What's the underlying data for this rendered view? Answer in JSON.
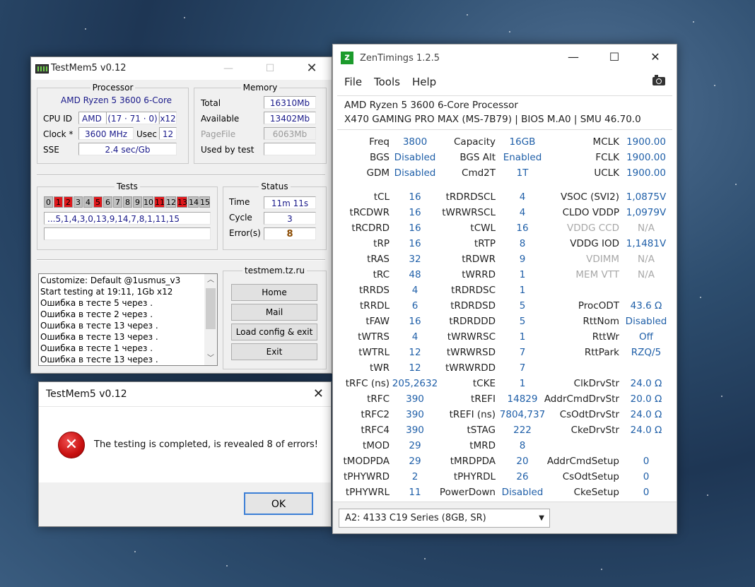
{
  "testmem": {
    "title": "TestMem5 v0.12",
    "processor": {
      "group": "Processor",
      "name": "AMD Ryzen 5 3600 6-Core",
      "cpuid_label": "CPU ID",
      "cpuid_vendor": "AMD",
      "cpuid_value": "(17 · 71 · 0)",
      "cpuid_mult": "x12",
      "clock_label": "Clock *",
      "clock_value": "3600 MHz",
      "usec_label": "Usec",
      "usec_value": "12",
      "sse_label": "SSE",
      "sse_value": "2.4 sec/Gb"
    },
    "memory": {
      "group": "Memory",
      "total_label": "Total",
      "total_value": "16310Mb",
      "available_label": "Available",
      "available_value": "13402Mb",
      "pagefile_label": "PageFile",
      "pagefile_value": "6063Mb",
      "used_label": "Used by test",
      "used_value": ""
    },
    "tests": {
      "group": "Tests",
      "cells": [
        {
          "n": "0",
          "s": "ok"
        },
        {
          "n": "1",
          "s": "err"
        },
        {
          "n": "2",
          "s": "err"
        },
        {
          "n": "3",
          "s": "ok"
        },
        {
          "n": "4",
          "s": "ok"
        },
        {
          "n": "5",
          "s": "err"
        },
        {
          "n": "6",
          "s": "ok"
        },
        {
          "n": "7",
          "s": "ok"
        },
        {
          "n": "8",
          "s": "ok"
        },
        {
          "n": "9",
          "s": "ok"
        },
        {
          "n": "10",
          "s": "ok"
        },
        {
          "n": "11",
          "s": "err"
        },
        {
          "n": "12",
          "s": "ok"
        },
        {
          "n": "13",
          "s": "err"
        },
        {
          "n": "14",
          "s": "ok"
        },
        {
          "n": "15",
          "s": "ok"
        }
      ],
      "sequence": "...5,1,4,3,0,13,9,14,7,8,1,11,15",
      "progress": ""
    },
    "status": {
      "group": "Status",
      "time_label": "Time",
      "time_value": "11m 11s",
      "cycle_label": "Cycle",
      "cycle_value": "3",
      "errors_label": "Error(s)",
      "errors_value": "8"
    },
    "log": [
      "Customize: Default @1usmus_v3",
      "Start testing at 19:11, 1Gb x12",
      "Ошибка в тесте 5 через .",
      "Ошибка в тесте 2 через .",
      "Ошибка в тесте 13 через .",
      "Ошибка в тесте 13 через .",
      "Ошибка в тесте 1 через .",
      "Ошибка в тесте 13 через ."
    ],
    "links": {
      "group": "testmem.tz.ru",
      "home": "Home",
      "mail": "Mail",
      "load": "Load config & exit",
      "exit": "Exit"
    }
  },
  "dialog": {
    "title": "TestMem5 v0.12",
    "message": "The testing is completed, is revealed 8 of errors!",
    "ok": "OK",
    "icon": "error-icon"
  },
  "zentimings": {
    "title": "ZenTimings 1.2.5",
    "menu": [
      "File",
      "Tools",
      "Help"
    ],
    "cpu": "AMD Ryzen 5 3600 6-Core Processor",
    "board": "X470 GAMING PRO MAX (MS-7B79) | BIOS M.A0 | SMU 46.70.0",
    "top": [
      [
        "Freq",
        "3800",
        "Capacity",
        "16GB",
        "MCLK",
        "1900.00"
      ],
      [
        "BGS",
        "Disabled",
        "BGS Alt",
        "Enabled",
        "FCLK",
        "1900.00"
      ],
      [
        "GDM",
        "Disabled",
        "Cmd2T",
        "1T",
        "UCLK",
        "1900.00"
      ]
    ],
    "rows": [
      [
        "tCL",
        "16",
        "tRDRDSCL",
        "4",
        "VSOC (SVI2)",
        "1,0875V"
      ],
      [
        "tRCDWR",
        "16",
        "tWRWRSCL",
        "4",
        "CLDO VDDP",
        "1,0979V"
      ],
      [
        "tRCDRD",
        "16",
        "tCWL",
        "16",
        "VDDG CCD",
        "N/A"
      ],
      [
        "tRP",
        "16",
        "tRTP",
        "8",
        "VDDG IOD",
        "1,1481V"
      ],
      [
        "tRAS",
        "32",
        "tRDWR",
        "9",
        "VDIMM",
        "N/A"
      ],
      [
        "tRC",
        "48",
        "tWRRD",
        "1",
        "MEM VTT",
        "N/A"
      ],
      [
        "tRRDS",
        "4",
        "tRDRDSC",
        "1",
        "",
        ""
      ],
      [
        "tRRDL",
        "6",
        "tRDRDSD",
        "5",
        "ProcODT",
        "43.6 Ω"
      ],
      [
        "tFAW",
        "16",
        "tRDRDDD",
        "5",
        "RttNom",
        "Disabled"
      ],
      [
        "tWTRS",
        "4",
        "tWRWRSC",
        "1",
        "RttWr",
        "Off"
      ],
      [
        "tWTRL",
        "12",
        "tWRWRSD",
        "7",
        "RttPark",
        "RZQ/5"
      ],
      [
        "tWR",
        "12",
        "tWRWRDD",
        "7",
        "",
        ""
      ],
      [
        "tRFC (ns)",
        "205,2632",
        "tCKE",
        "1",
        "ClkDrvStr",
        "24.0 Ω"
      ],
      [
        "tRFC",
        "390",
        "tREFI",
        "14829",
        "AddrCmdDrvStr",
        "20.0 Ω"
      ],
      [
        "tRFC2",
        "390",
        "tREFI (ns)",
        "7804,737",
        "CsOdtDrvStr",
        "24.0 Ω"
      ],
      [
        "tRFC4",
        "390",
        "tSTAG",
        "222",
        "CkeDrvStr",
        "24.0 Ω"
      ],
      [
        "tMOD",
        "29",
        "tMRD",
        "8",
        "",
        ""
      ],
      [
        "tMODPDA",
        "29",
        "tMRDPDA",
        "20",
        "AddrCmdSetup",
        "0"
      ],
      [
        "tPHYWRD",
        "2",
        "tPHYRDL",
        "26",
        "CsOdtSetup",
        "0"
      ],
      [
        "tPHYWRL",
        "11",
        "PowerDown",
        "Disabled",
        "CkeSetup",
        "0"
      ]
    ],
    "dim_labels": [
      "VDDG CCD",
      "VDIMM",
      "MEM VTT"
    ],
    "module": "A2: 4133 C19 Series (8GB, SR)"
  }
}
